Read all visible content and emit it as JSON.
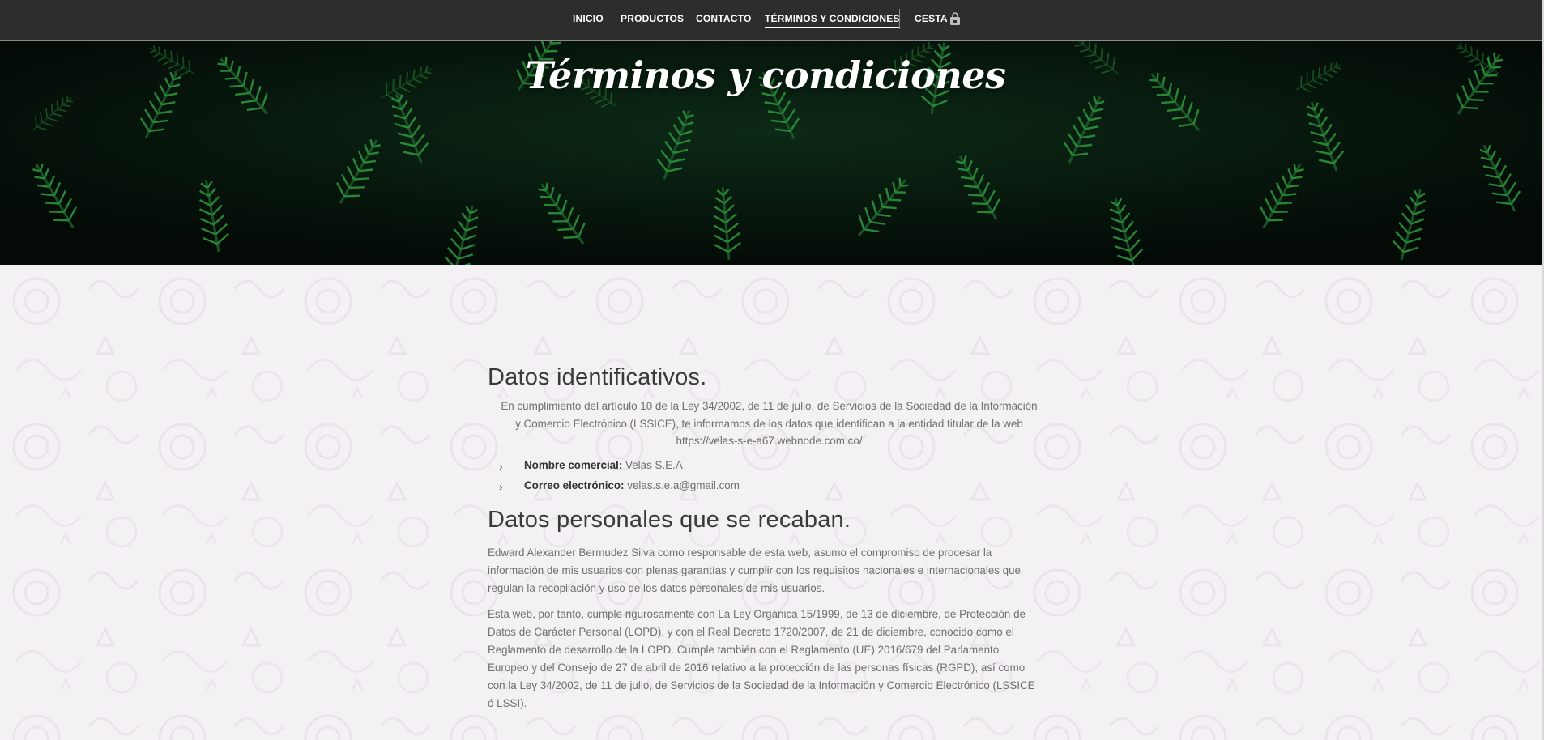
{
  "nav": {
    "items": [
      {
        "label": "INICIO"
      },
      {
        "label": "PRODUCTOS"
      },
      {
        "label": "CONTACTO"
      },
      {
        "label": "TÉRMINOS Y CONDICIONES"
      }
    ],
    "cart_label": "CESTA",
    "cart_icon": "shopping-bag-icon"
  },
  "hero": {
    "title": "Términos y condiciones"
  },
  "section1": {
    "heading": "Datos identificativos.",
    "intro_line1": "En cumplimiento del artículo 10 de la Ley 34/2002, de 11 de julio, de Servicios de la Sociedad de la Información",
    "intro_line2": "y Comercio Electrónico (LSSICE), te informamos de los datos que identifican a la entidad titular de la web",
    "intro_line3": "https://velas-s-e-a67.webnode.com.co/",
    "items": [
      {
        "label": "Nombre comercial:",
        "value": "Velas S.E.A"
      },
      {
        "label": "Correo electrónico:",
        "value": "velas.s.e.a@gmail.com"
      }
    ]
  },
  "section2": {
    "heading": "Datos personales que se recaban.",
    "p1": [
      "Edward Alexander Bermudez Silva como responsable de esta web, asumo el compromiso de procesar la",
      "información de mis usuarios con plenas garantías y cumplir con los requisitos nacionales e internacionales que",
      "regulan la recopilación y uso de los datos personales de mis usuarios."
    ],
    "p2": [
      "Esta web, por tanto, cumple rigurosamente con La Ley Orgánica 15/1999, de 13 de diciembre, de Protección de",
      "Datos de Carácter Personal (LOPD), y con el Real Decreto 1720/2007, de 21 de diciembre, conocido como el",
      "Reglamento de desarrollo de la LOPD. Cumple también con el Reglamento (UE) 2016/679 del Parlamento",
      "Europeo y del Consejo de 27 de abril de 2016 relativo a la protección de las personas físicas (RGPD), así como",
      "con la Ley 34/2002, de 11 de julio, de Servicios de la Sociedad de la Información y Comercio Electrónico (LSSICE",
      "ó LSSI)."
    ]
  },
  "colors": {
    "nav_bg": "#2d2d2d",
    "page_bg": "#f4f1f4",
    "hero_bg": "#06120b",
    "heading": "#3a3a3a",
    "body_text": "#6f6f6f"
  }
}
